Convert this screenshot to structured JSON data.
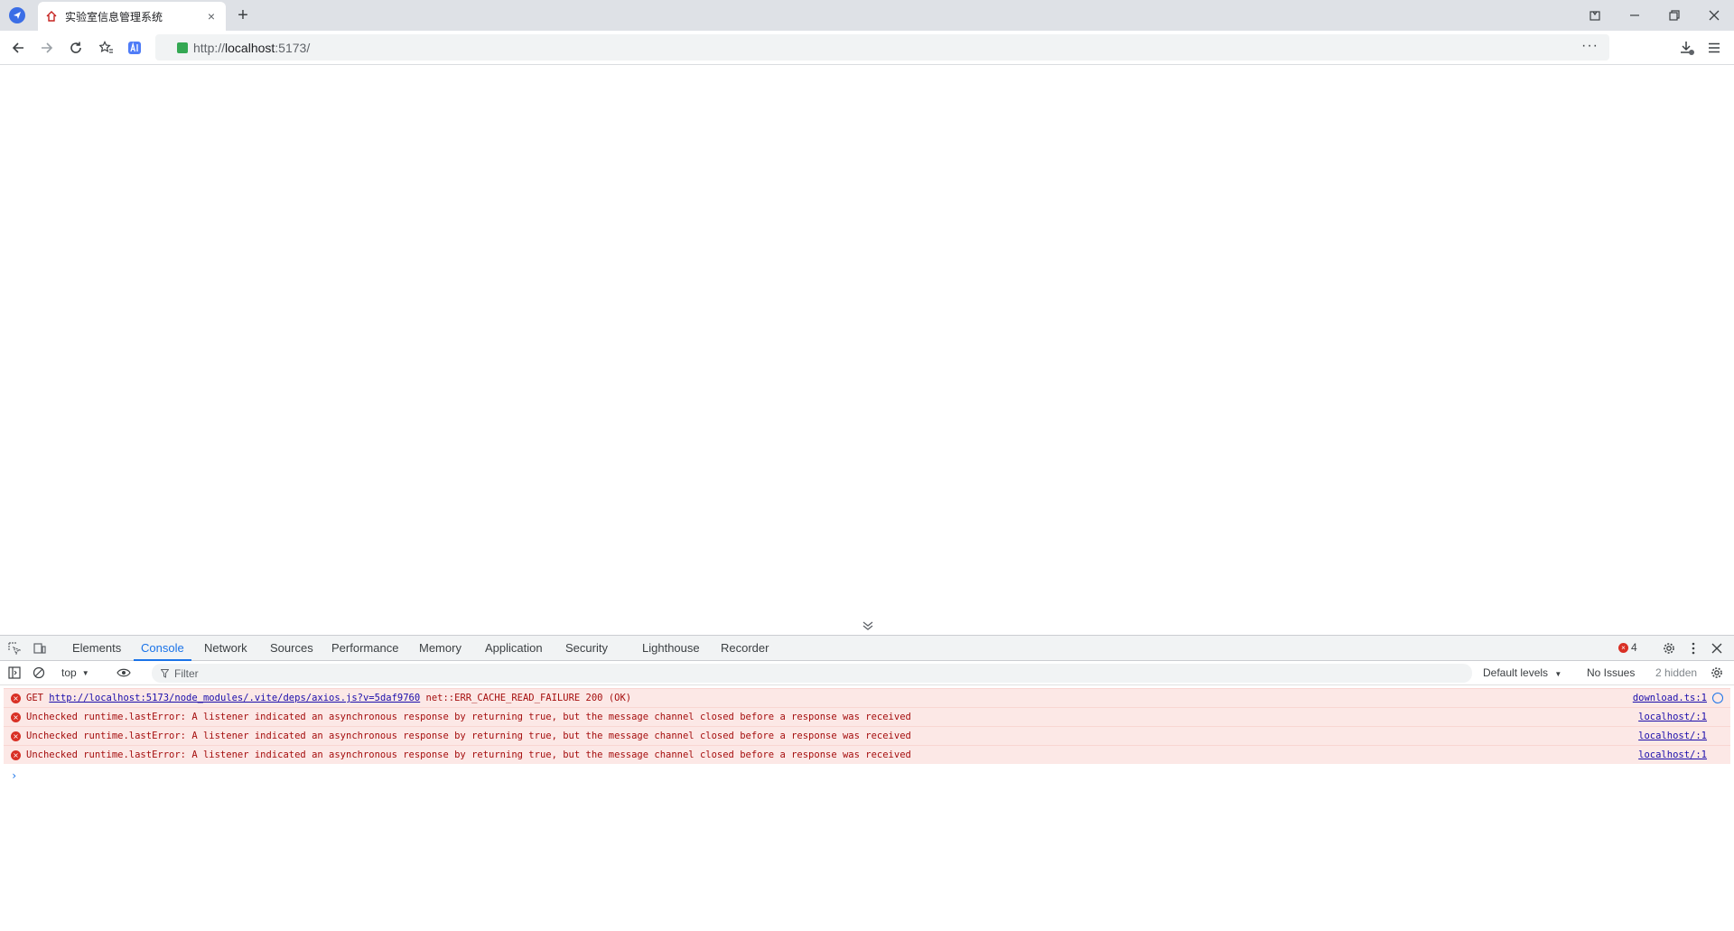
{
  "browser": {
    "tab": {
      "title": "实验室信息管理系统"
    },
    "omnibox": {
      "url_scheme": "http://",
      "url_host": "localhost",
      "url_rest": ":5173/"
    }
  },
  "devtools": {
    "tabs": [
      "Elements",
      "Console",
      "Network",
      "Sources",
      "Performance",
      "Memory",
      "Application",
      "Security",
      "Lighthouse",
      "Recorder"
    ],
    "active_tab": "Console",
    "error_count": "4",
    "console_toolbar": {
      "context": "top",
      "filter_placeholder": "Filter",
      "levels": "Default levels",
      "issues": "No Issues",
      "hidden": "2 hidden"
    },
    "messages": [
      {
        "prefix": "GET ",
        "link": "http://localhost:5173/node_modules/.vite/deps/axios.js?v=5daf9760",
        "text": " net::ERR_CACHE_READ_FAILURE 200 (OK)",
        "source": "download.ts:1"
      },
      {
        "prefix": "",
        "link": "",
        "text": "Unchecked runtime.lastError: A listener indicated an asynchronous response by returning true, but the message channel closed before a response was received",
        "source": "localhost/:1"
      },
      {
        "prefix": "",
        "link": "",
        "text": "Unchecked runtime.lastError: A listener indicated an asynchronous response by returning true, but the message channel closed before a response was received",
        "source": "localhost/:1"
      },
      {
        "prefix": "",
        "link": "",
        "text": "Unchecked runtime.lastError: A listener indicated an asynchronous response by returning true, but the message channel closed before a response was received",
        "source": "localhost/:1"
      }
    ],
    "prompt": "›"
  },
  "icons": {
    "error": "×",
    "close": "×",
    "new_tab": "+"
  }
}
